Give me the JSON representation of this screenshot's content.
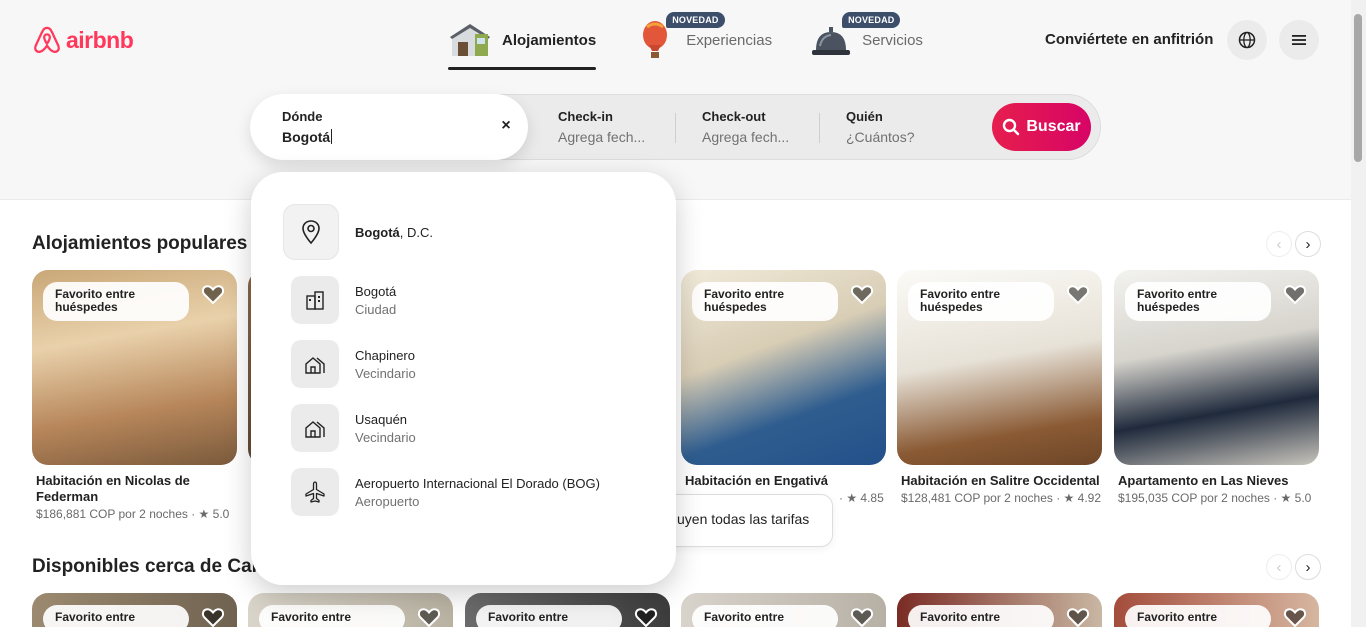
{
  "brand": {
    "name": "airbnb",
    "color": "#ff385c"
  },
  "nav": {
    "tabs": [
      {
        "label": "Alojamientos",
        "icon": "house-icon",
        "badge": ""
      },
      {
        "label": "Experiencias",
        "icon": "hot-air-balloon-icon",
        "badge": "NOVEDAD"
      },
      {
        "label": "Servicios",
        "icon": "service-bell-icon",
        "badge": "NOVEDAD"
      }
    ],
    "host_link": "Conviértete en anfitrión"
  },
  "search": {
    "where_label": "Dónde",
    "where_value": "Bogotá",
    "checkin_label": "Check-in",
    "checkin_value": "Agrega fech...",
    "checkout_label": "Check-out",
    "checkout_value": "Agrega fech...",
    "who_label": "Quién",
    "who_value": "¿Cuántos?",
    "button_label": "Buscar"
  },
  "suggestions": [
    {
      "bold": "Bogotá",
      "rest": ", D.C.",
      "sub": "",
      "icon": "location-pin-icon"
    },
    {
      "bold": "",
      "rest": "Bogotá",
      "sub": "Ciudad",
      "icon": "city-buildings-icon"
    },
    {
      "bold": "",
      "rest": "Chapinero",
      "sub": "Vecindario",
      "icon": "neighborhood-houses-icon"
    },
    {
      "bold": "",
      "rest": "Usaquén",
      "sub": "Vecindario",
      "icon": "neighborhood-houses-icon"
    },
    {
      "bold": "",
      "rest": "Aeropuerto Internacional El Dorado (BOG)",
      "sub": "Aeropuerto",
      "icon": "airplane-icon"
    }
  ],
  "sections": {
    "popular_title": "Alojamientos populares en",
    "nearby_title": "Disponibles cerca de Carta"
  },
  "cards": [
    {
      "badge": "Favorito entre huéspedes",
      "title": "Habitación en Nicolas de Federman",
      "sub": "$186,881 COP por 2 noches · ★ 5.0"
    },
    {
      "badge": "Favorito entre huéspedes",
      "title": "Habitación en Engativá",
      "sub": "· ★ 4.85"
    },
    {
      "badge": "Favorito entre huéspedes",
      "title": "Habitación en Salitre Occidental",
      "sub": "$128,481 COP por 2 noches · ★ 4.92"
    },
    {
      "badge": "Favorito entre huéspedes",
      "title": "Apartamento en Las Nieves",
      "sub": "$195,035 COP por 2 noches · ★ 5.0"
    }
  ],
  "row2_badge": "Favorito entre",
  "toast": "uyen todas las tarifas"
}
